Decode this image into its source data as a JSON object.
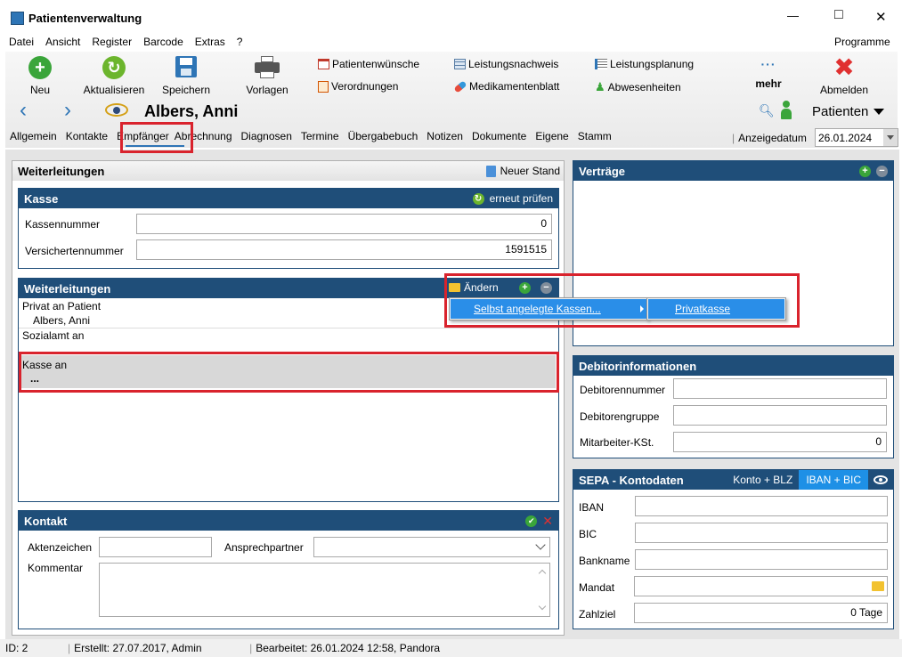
{
  "window": {
    "title": "Patientenverwaltung",
    "min": "—",
    "max": "□",
    "close": "✕"
  },
  "menu": {
    "items": [
      "Datei",
      "Ansicht",
      "Register",
      "Barcode",
      "Extras",
      "?"
    ],
    "right": "Programme"
  },
  "toolbar": {
    "neu": "Neu",
    "aktualisieren": "Aktualisieren",
    "speichern": "Speichern",
    "vorlagen": "Vorlagen",
    "patientenwuensche": "Patientenwünsche",
    "verordnungen": "Verordnungen",
    "leistungsnachweis": "Leistungsnachweis",
    "medikamentenblatt": "Medikamentenblatt",
    "leistungsplanung": "Leistungsplanung",
    "abwesenheiten": "Abwesenheiten",
    "mehr_dots": "···",
    "mehr": "mehr",
    "abmelden": "Abmelden"
  },
  "nav": {
    "patient_name": "Albers, Anni",
    "patienten": "Patienten"
  },
  "tabs": [
    "Allgemein",
    "Kontakte",
    "Empfänger",
    "Abrechnung",
    "Diagnosen",
    "Termine",
    "Übergabebuch",
    "Notizen",
    "Dokumente",
    "Eigene",
    "Stamm"
  ],
  "anzeigedatum": {
    "label": "Anzeigedatum",
    "value": "26.01.2024"
  },
  "weiterleitungen_outer": {
    "title": "Weiterleitungen",
    "neuer_stand": "Neuer Stand"
  },
  "kasse": {
    "title": "Kasse",
    "pruefen": "erneut prüfen",
    "kassennummer_label": "Kassennummer",
    "kassennummer": "0",
    "versicherten_label": "Versichertennummer",
    "versicherten": "1591515"
  },
  "weiterleitungen": {
    "title": "Weiterleitungen",
    "aendern": "Ändern",
    "privat": "Privat an Patient",
    "privat_name": "Albers, Anni",
    "sozialamt": "Sozialamt an",
    "kasse_an": "Kasse an",
    "kasse_val": "..."
  },
  "context_menu": {
    "item": "Selbst angelegte Kassen...",
    "sub": "Privatkasse"
  },
  "kontakt": {
    "title": "Kontakt",
    "aktenzeichen": "Aktenzeichen",
    "ansprechpartner": "Ansprechpartner",
    "kommentar": "Kommentar"
  },
  "vertraege": {
    "title": "Verträge"
  },
  "debitor": {
    "title": "Debitorinformationen",
    "nummer": "Debitorennummer",
    "gruppe": "Debitorengruppe",
    "kst": "Mitarbeiter-KSt.",
    "kst_val": "0"
  },
  "sepa": {
    "title": "SEPA - Kontodaten",
    "konto": "Konto + BLZ",
    "iban_bic": "IBAN + BIC",
    "iban": "IBAN",
    "bic": "BIC",
    "bankname": "Bankname",
    "mandat": "Mandat",
    "zahlziel": "Zahlziel",
    "zahlziel_val": "0 Tage"
  },
  "status": {
    "id": "ID: 2",
    "erstellt": "Erstellt: 27.07.2017, Admin",
    "bearbeitet": "Bearbeitet: 26.01.2024 12:58, Pandora"
  }
}
